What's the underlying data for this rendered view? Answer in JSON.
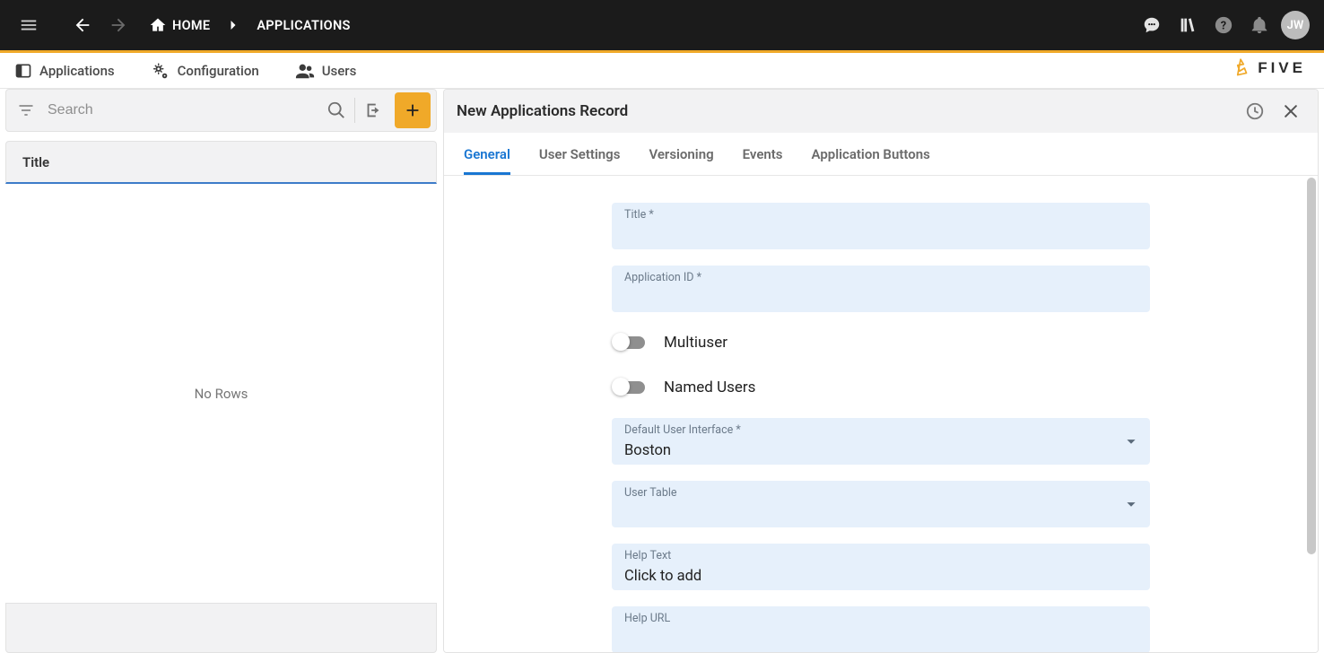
{
  "appbar": {
    "home_label": "HOME",
    "current_label": "APPLICATIONS",
    "avatar_initials": "JW"
  },
  "subnav": {
    "tab_applications": "Applications",
    "tab_configuration": "Configuration",
    "tab_users": "Users",
    "brand": "FIVE"
  },
  "left": {
    "search_placeholder": "Search",
    "column_header": "Title",
    "empty_text": "No Rows"
  },
  "form": {
    "header_title": "New Applications Record",
    "tabs": {
      "general": "General",
      "user_settings": "User Settings",
      "versioning": "Versioning",
      "events": "Events",
      "app_buttons": "Application Buttons"
    },
    "fields": {
      "title": {
        "label": "Title *",
        "value": ""
      },
      "app_id": {
        "label": "Application ID *",
        "value": ""
      },
      "multiuser": {
        "label": "Multiuser",
        "on": false
      },
      "named_users": {
        "label": "Named Users",
        "on": false
      },
      "default_ui": {
        "label": "Default User Interface *",
        "value": "Boston"
      },
      "user_table": {
        "label": "User Table",
        "value": ""
      },
      "help_text": {
        "label": "Help Text",
        "value": "Click to add"
      },
      "help_url": {
        "label": "Help URL",
        "value": ""
      }
    }
  }
}
